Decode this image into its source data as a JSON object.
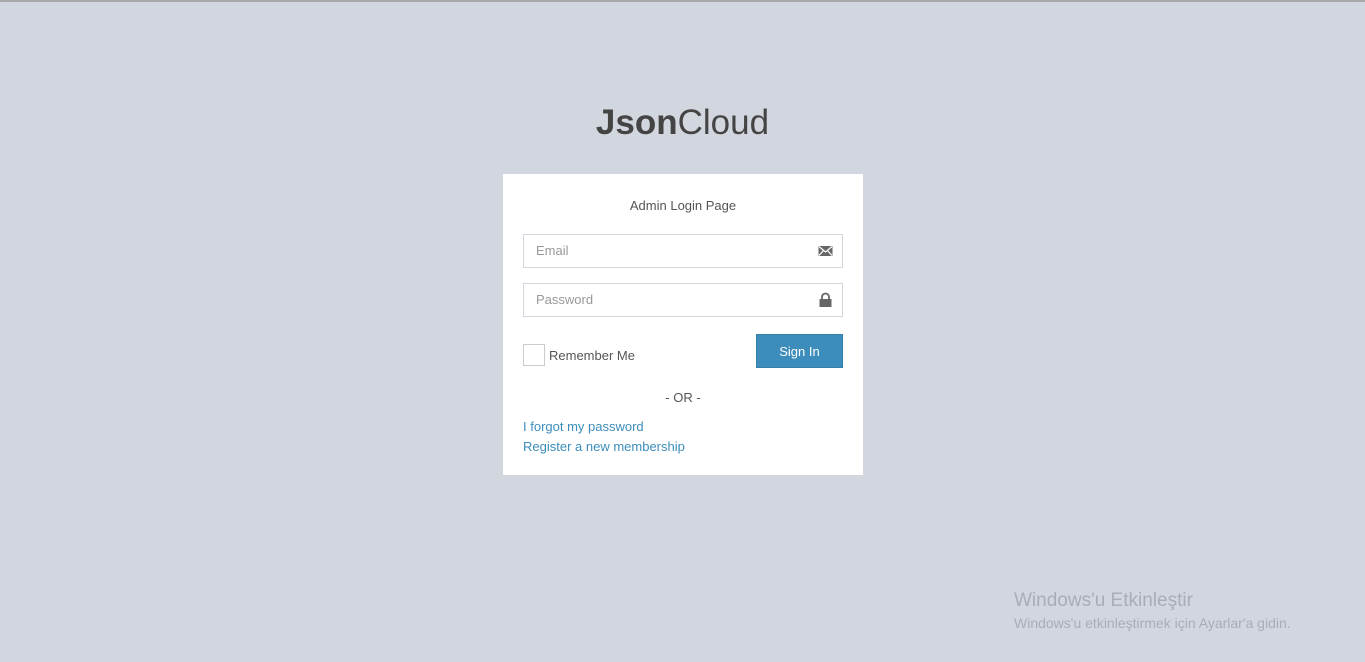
{
  "logo": {
    "bold": "Json",
    "light": "Cloud"
  },
  "login": {
    "message": "Admin Login Page",
    "email_placeholder": "Email",
    "password_placeholder": "Password",
    "remember_label": "Remember Me",
    "sign_in_label": "Sign In",
    "or_label": "- OR -",
    "forgot_link": "I forgot my password",
    "register_link": "Register a new membership"
  },
  "watermark": {
    "title": "Windows'u Etkinleştir",
    "subtitle": "Windows'u etkinleştirmek için Ayarlar'a gidin."
  }
}
